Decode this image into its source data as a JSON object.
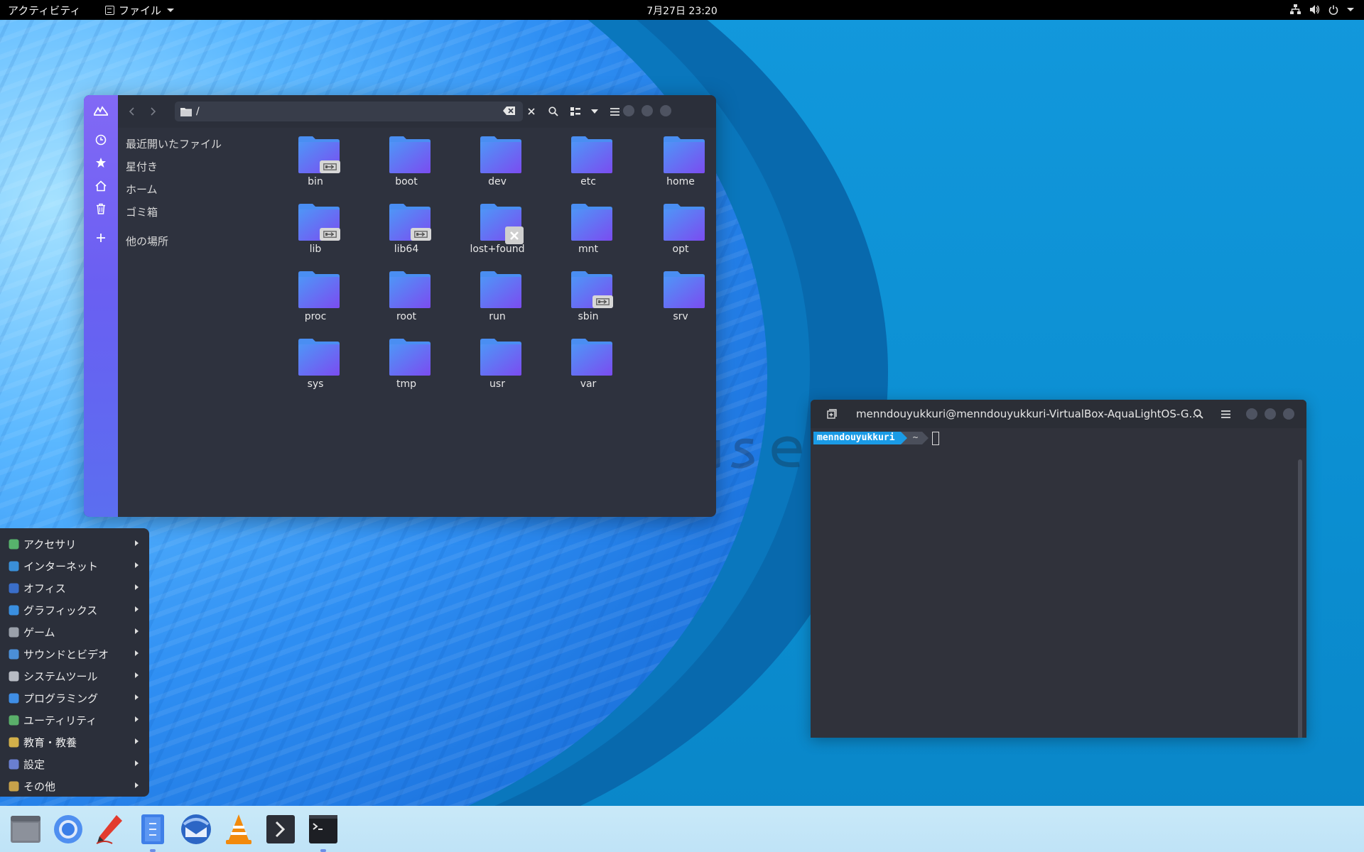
{
  "topbar": {
    "activities": "アクティビティ",
    "app_menu": "ファイル",
    "clock": "7月27日  23:20",
    "icons": [
      "network-icon",
      "volume-icon",
      "power-icon"
    ]
  },
  "file_manager": {
    "path": "/",
    "sidebar": {
      "recent": "最近開いたファイル",
      "starred": "星付き",
      "home": "ホーム",
      "trash": "ゴミ箱",
      "other": "他の場所"
    },
    "items": [
      {
        "name": "bin",
        "emblem": "symlink"
      },
      {
        "name": "boot",
        "emblem": ""
      },
      {
        "name": "dev",
        "emblem": ""
      },
      {
        "name": "etc",
        "emblem": ""
      },
      {
        "name": "home",
        "emblem": ""
      },
      {
        "name": "lib",
        "emblem": "symlink"
      },
      {
        "name": "lib64",
        "emblem": "symlink"
      },
      {
        "name": "lost+found",
        "emblem": "unreadable"
      },
      {
        "name": "mnt",
        "emblem": ""
      },
      {
        "name": "opt",
        "emblem": ""
      },
      {
        "name": "proc",
        "emblem": ""
      },
      {
        "name": "root",
        "emblem": ""
      },
      {
        "name": "run",
        "emblem": ""
      },
      {
        "name": "sbin",
        "emblem": "symlink"
      },
      {
        "name": "srv",
        "emblem": ""
      },
      {
        "name": "sys",
        "emblem": ""
      },
      {
        "name": "tmp",
        "emblem": ""
      },
      {
        "name": "usr",
        "emblem": ""
      },
      {
        "name": "var",
        "emblem": ""
      }
    ],
    "colors": {
      "rail_top": "#8269f5",
      "rail_bottom": "#5b6ef0",
      "folder_top": "#4f95f7",
      "folder_bottom": "#7b4cf0"
    }
  },
  "terminal": {
    "title": "menndouyukkuri@menndouyukkuri-VirtualBox-AquaLightOS-G...",
    "prompt_user": "menndouyukkuri",
    "prompt_dir": "~"
  },
  "apps_menu": {
    "items": [
      {
        "label": "アクセサリ",
        "icon": "accessories-icon"
      },
      {
        "label": "インターネット",
        "icon": "internet-icon"
      },
      {
        "label": "オフィス",
        "icon": "office-icon"
      },
      {
        "label": "グラフィックス",
        "icon": "graphics-icon"
      },
      {
        "label": "ゲーム",
        "icon": "games-icon"
      },
      {
        "label": "サウンドとビデオ",
        "icon": "sound-video-icon"
      },
      {
        "label": "システムツール",
        "icon": "system-tools-icon"
      },
      {
        "label": "プログラミング",
        "icon": "programming-icon"
      },
      {
        "label": "ユーティリティ",
        "icon": "utilities-icon"
      },
      {
        "label": "教育・教養",
        "icon": "education-icon"
      },
      {
        "label": "設定",
        "icon": "settings-icon"
      },
      {
        "label": "その他",
        "icon": "other-icon"
      }
    ]
  },
  "dock": {
    "apps": [
      "files-icon",
      "chromium-icon",
      "text-editor-icon",
      "file-manager-icon",
      "thunderbird-icon",
      "vlc-icon",
      "terminal-prompt-icon",
      "terminal-icon"
    ]
  }
}
